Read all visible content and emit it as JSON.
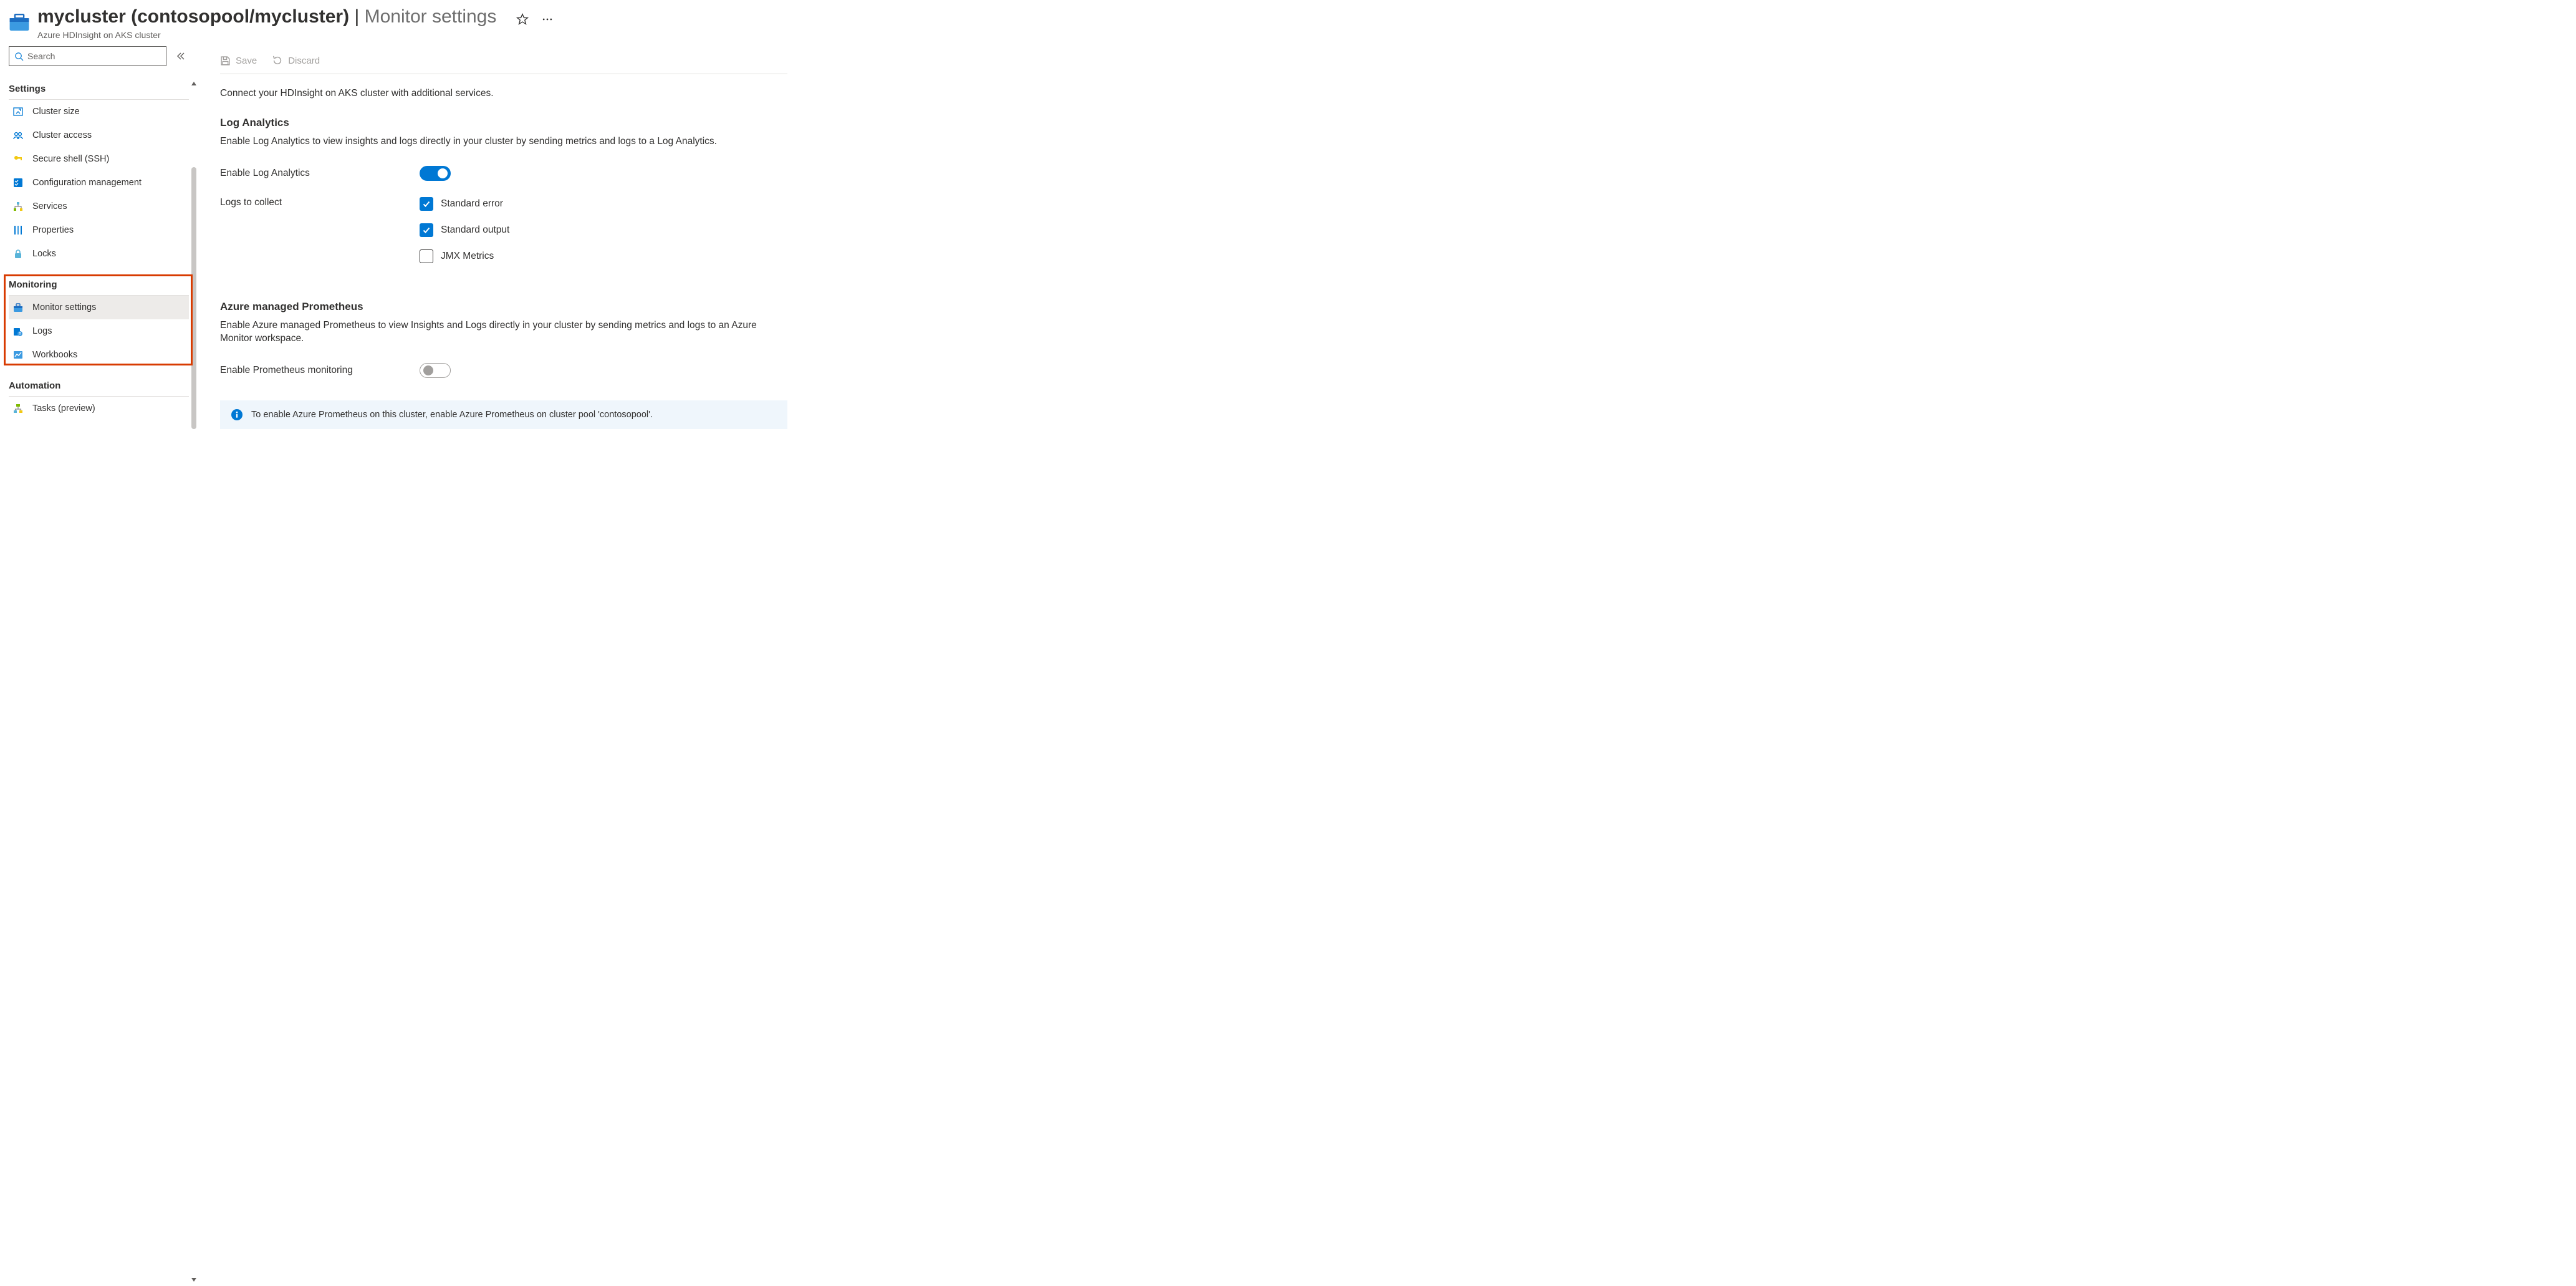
{
  "header": {
    "title_prefix": "mycluster (contosopool/mycluster)",
    "title_section": "Monitor settings",
    "subtitle": "Azure HDInsight on AKS cluster"
  },
  "search": {
    "placeholder": "Search"
  },
  "sidebar": {
    "groups": [
      {
        "title": "Settings",
        "items": [
          {
            "label": "Cluster size",
            "icon": "scale",
            "selected": false
          },
          {
            "label": "Cluster access",
            "icon": "people",
            "selected": false
          },
          {
            "label": "Secure shell (SSH)",
            "icon": "key",
            "selected": false
          },
          {
            "label": "Configuration management",
            "icon": "checklist",
            "selected": false
          },
          {
            "label": "Services",
            "icon": "hierarchy",
            "selected": false
          },
          {
            "label": "Properties",
            "icon": "properties",
            "selected": false
          },
          {
            "label": "Locks",
            "icon": "lock",
            "selected": false
          }
        ]
      },
      {
        "title": "Monitoring",
        "items": [
          {
            "label": "Monitor settings",
            "icon": "monitor",
            "selected": true
          },
          {
            "label": "Logs",
            "icon": "logs",
            "selected": false
          },
          {
            "label": "Workbooks",
            "icon": "workbook",
            "selected": false
          }
        ]
      },
      {
        "title": "Automation",
        "items": [
          {
            "label": "Tasks (preview)",
            "icon": "tasks",
            "selected": false
          }
        ]
      }
    ]
  },
  "commands": {
    "save": "Save",
    "discard": "Discard"
  },
  "main": {
    "intro": "Connect your HDInsight on AKS cluster with additional services.",
    "log_analytics": {
      "title": "Log Analytics",
      "desc": "Enable Log Analytics to view insights and logs directly in your cluster by sending metrics and logs to a Log Analytics.",
      "enable_label": "Enable Log Analytics",
      "enabled": true,
      "logs_label": "Logs to collect",
      "options": [
        {
          "label": "Standard error",
          "checked": true
        },
        {
          "label": "Standard output",
          "checked": true
        },
        {
          "label": "JMX Metrics",
          "checked": false
        }
      ]
    },
    "prometheus": {
      "title": "Azure managed Prometheus",
      "desc": "Enable Azure managed Prometheus to view Insights and Logs directly in your cluster by sending metrics and logs to an Azure Monitor workspace.",
      "enable_label": "Enable Prometheus monitoring",
      "enabled": false,
      "info": "To enable Azure Prometheus on this cluster, enable Azure Prometheus on cluster pool 'contosopool'."
    }
  }
}
